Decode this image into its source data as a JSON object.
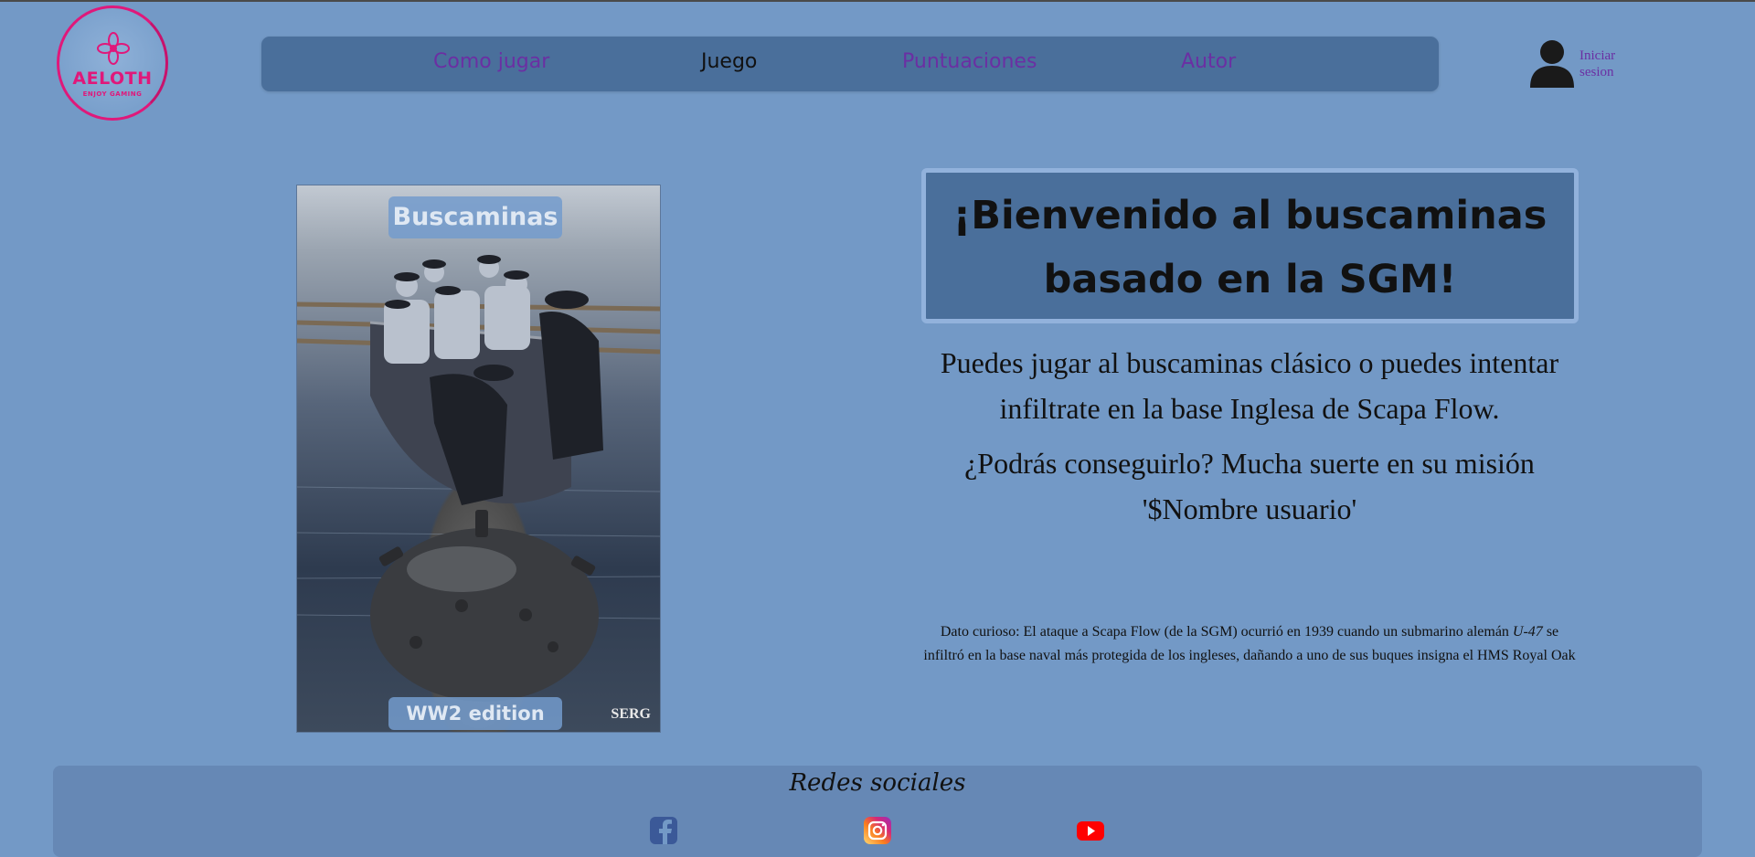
{
  "logo": {
    "brand": "AELOTH",
    "tagline": "ENJOY GAMING"
  },
  "nav": {
    "items": [
      {
        "label": "Como jugar"
      },
      {
        "label": "Juego"
      },
      {
        "label": "Puntuaciones"
      },
      {
        "label": "Autor"
      }
    ],
    "active": "Juego"
  },
  "user": {
    "login_label_line1": "Iniciar",
    "login_label_line2": "sesion"
  },
  "poster": {
    "title": "Buscaminas",
    "edition": "WW2 edition",
    "signature": "SERG"
  },
  "main": {
    "welcome_line1": "¡Bienvenido al buscaminas",
    "welcome_line2": "basado en la SGM!",
    "intro_1": "Puedes jugar al buscaminas clásico o puedes intentar infiltrate en la base Inglesa de Scapa Flow.",
    "intro_2": "¿Podrás conseguirlo? Mucha suerte en su misión '$Nombre usuario'",
    "fact_prefix": "Dato curioso: El ataque a Scapa Flow (de la SGM) ocurrió en 1939 cuando un submarino alemán",
    "fact_em": "U-47",
    "fact_suffix": "se infiltró en la base naval más protegida de los ingleses, dañando a uno de sus buques insigna el HMS Royal Oak"
  },
  "footer": {
    "title": "Redes sociales",
    "icons": [
      "facebook-icon",
      "instagram-icon",
      "youtube-icon"
    ]
  },
  "colors": {
    "background": "#7399c6",
    "panel": "#4a6f9b",
    "link": "#6b2fa3",
    "brand": "#e0187a"
  }
}
